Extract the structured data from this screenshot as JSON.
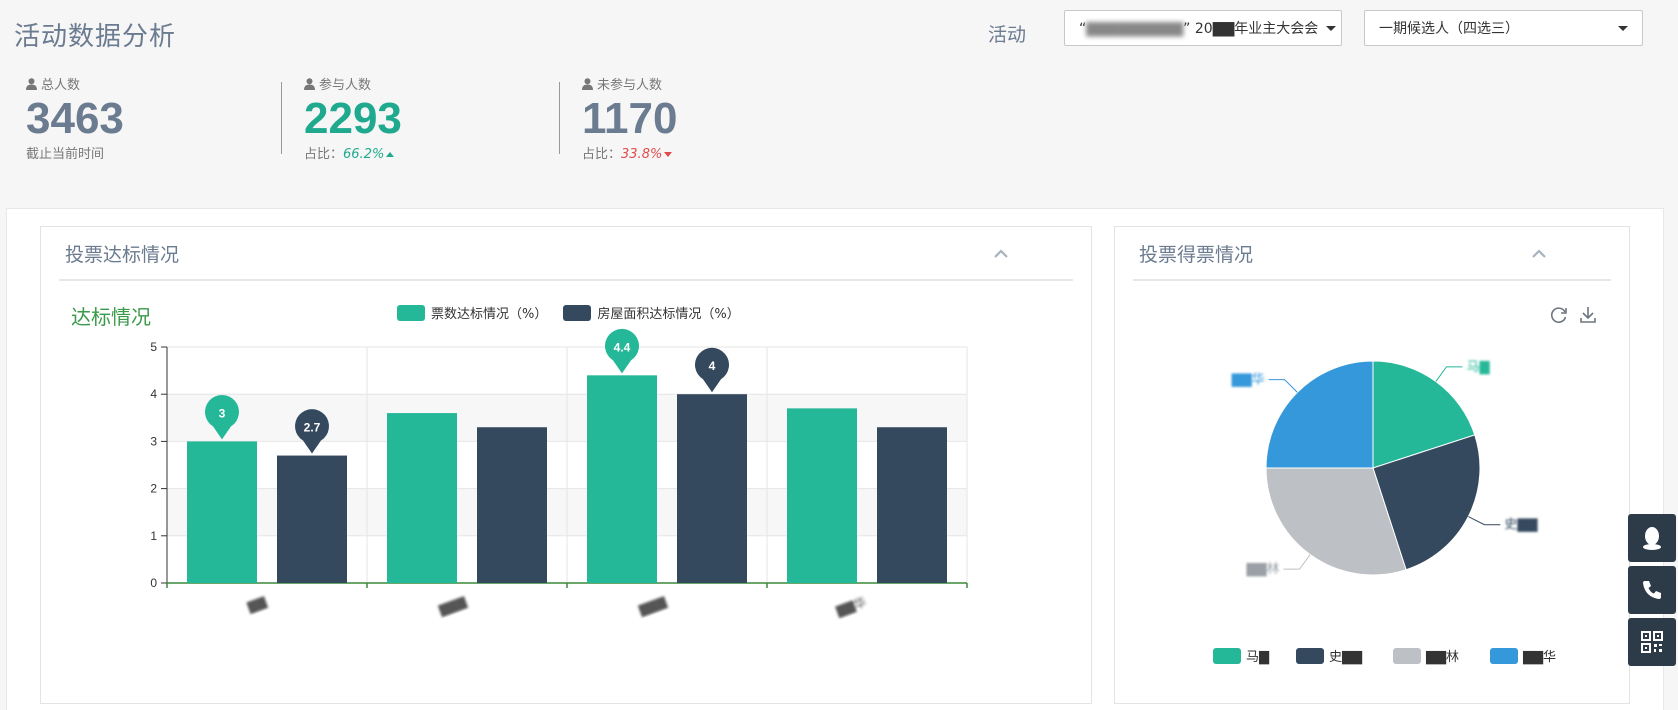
{
  "header": {
    "title": "活动数据分析",
    "filter_label": "活动",
    "activity_select": {
      "prefix": "“",
      "blurred": "▇▇▇▇▇▇▇▇▇",
      "suffix": "” 20▇▇年业主大会会"
    },
    "candidate_select": {
      "value": "一期候选人（四选三）"
    }
  },
  "stats": {
    "total": {
      "label": "总人数",
      "value": "3463",
      "sub": "截止当前时间"
    },
    "participated": {
      "label": "参与人数",
      "value": "2293",
      "sub_prefix": "占比：",
      "pct": "66.2%",
      "color": "#1fa98e"
    },
    "not_participated": {
      "label": "未参与人数",
      "value": "1170",
      "sub_prefix": "占比：",
      "pct": "33.8%",
      "color": "#6b7b90"
    }
  },
  "panels": {
    "left": {
      "title": "投票达标情况",
      "subtitle": "达标情况"
    },
    "right": {
      "title": "投票得票情况"
    }
  },
  "colors": {
    "teal": "#25b898",
    "navy": "#34495e",
    "grey": "#bdc1c5",
    "blue": "#3498db"
  },
  "chart_data": [
    {
      "type": "bar",
      "title": "达标情况",
      "categories": [
        "▇▇",
        "▇▇▇",
        "▇▇▇",
        "▇▇华"
      ],
      "series": [
        {
          "name": "票数达标情况（%）",
          "values": [
            3,
            3.6,
            4.4,
            3.7
          ],
          "color": "#25b898"
        },
        {
          "name": "房屋面积达标情况（%）",
          "values": [
            2.7,
            3.3,
            4,
            3.3
          ],
          "color": "#34495e"
        }
      ],
      "markers": [
        {
          "series": 0,
          "index": 0,
          "label": "3"
        },
        {
          "series": 1,
          "index": 0,
          "label": "2.7"
        },
        {
          "series": 0,
          "index": 2,
          "label": "4.4"
        },
        {
          "series": 1,
          "index": 2,
          "label": "4"
        }
      ],
      "ylim": [
        0,
        5
      ],
      "yticks": [
        "0",
        "1",
        "2",
        "3",
        "4",
        "5"
      ],
      "grid": true,
      "legend_position": "top-center"
    },
    {
      "type": "pie",
      "slices": [
        {
          "name": "马▇",
          "value": 20,
          "color": "#25b898"
        },
        {
          "name": "史▇▇",
          "value": 25,
          "color": "#34495e"
        },
        {
          "name": "▇▇林",
          "value": 30,
          "color": "#bdc1c5"
        },
        {
          "name": "▇▇华",
          "value": 25,
          "color": "#3498db"
        }
      ],
      "legend_position": "bottom-center"
    }
  ]
}
